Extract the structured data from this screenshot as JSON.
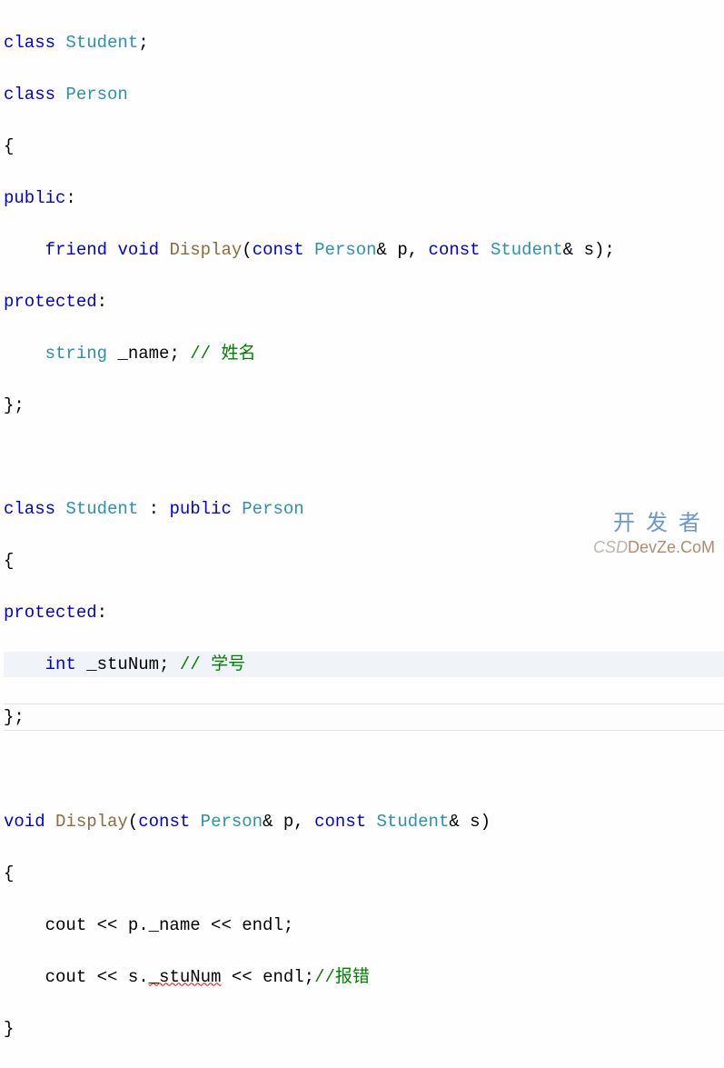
{
  "code": {
    "l1": {
      "t1": "class ",
      "t2": "Student",
      "t3": ";"
    },
    "l2": {
      "t1": "class ",
      "t2": "Person"
    },
    "l3": {
      "t1": "{"
    },
    "l4": {
      "t1": "public",
      "t2": ":"
    },
    "l5": {
      "t1": "    ",
      "t2": "friend ",
      "t3": "void ",
      "t4": "Display",
      "t5": "(",
      "t6": "const ",
      "t7": "Person",
      "t8": "& p, ",
      "t9": "const ",
      "t10": "Student",
      "t11": "& s);"
    },
    "l6": {
      "t1": "protected",
      "t2": ":"
    },
    "l7": {
      "t1": "    ",
      "t2": "string",
      "t3": " _name; ",
      "t4": "// 姓名"
    },
    "l8": {
      "t1": "};"
    },
    "l9": {
      "t1": ""
    },
    "l10": {
      "t1": "class ",
      "t2": "Student ",
      "t3": ": ",
      "t4": "public ",
      "t5": "Person"
    },
    "l11": {
      "t1": "{"
    },
    "l12": {
      "t1": "protected",
      "t2": ":"
    },
    "l13": {
      "t1": "    ",
      "t2": "int",
      "t3": " _stuNum; ",
      "t4": "// 学号"
    },
    "l14": {
      "t1": "};"
    },
    "l15": {
      "t1": ""
    },
    "l16": {
      "t1": "void ",
      "t2": "Display",
      "t3": "(",
      "t4": "const ",
      "t5": "Person",
      "t6": "& p, ",
      "t7": "const ",
      "t8": "Student",
      "t9": "& s)"
    },
    "l17": {
      "t1": "{"
    },
    "l18": {
      "t1": "    cout << p._name << endl;"
    },
    "l19": {
      "t1": "    cout << s.",
      "t2": "_stuNum",
      "t3": " << endl;",
      "t4": "//报错"
    },
    "l20": {
      "t1": "}"
    }
  },
  "watermark": {
    "text1": "开发者",
    "csdn": "CSD",
    "devze": "DevZe.CoM"
  }
}
